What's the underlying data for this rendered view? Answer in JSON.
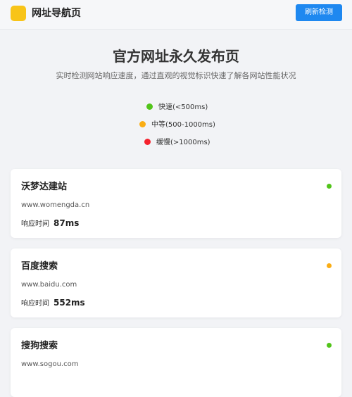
{
  "header": {
    "site_name": "网址导航页",
    "refresh_label": "刷新检测"
  },
  "hero": {
    "title": "官方网址永久发布页",
    "subtitle": "实时检测网站响应速度，通过直观的视觉标识快速了解各网站性能状况"
  },
  "legend": [
    {
      "label": "快速(<500ms)",
      "color": "#52c41a"
    },
    {
      "label": "中等(500-1000ms)",
      "color": "#faad14"
    },
    {
      "label": "缓慢(>1000ms)",
      "color": "#f5222d"
    }
  ],
  "response_time_label": "响应时间",
  "sites": [
    {
      "name": "沃梦达建站",
      "url": "www.womengda.cn",
      "response_time": "87ms",
      "status_color": "#52c41a"
    },
    {
      "name": "百度搜索",
      "url": "www.baidu.com",
      "response_time": "552ms",
      "status_color": "#faad14"
    },
    {
      "name": "搜狗搜索",
      "url": "www.sogou.com",
      "response_time": "",
      "status_color": "#52c41a"
    }
  ],
  "colors": {
    "accent": "#1e88f0",
    "logo": "#f8c418",
    "background": "#f2f3f6"
  }
}
